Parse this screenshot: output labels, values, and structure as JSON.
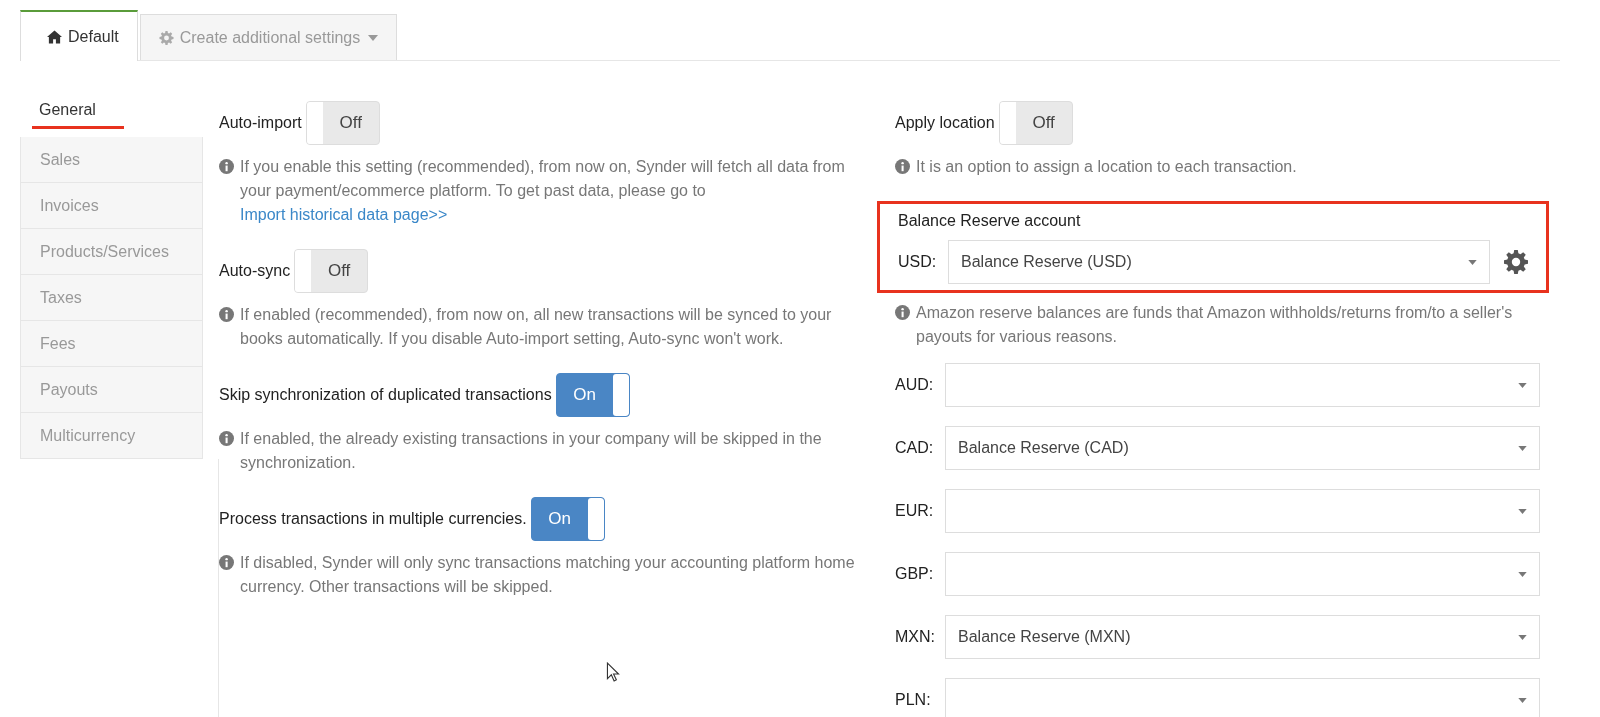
{
  "tabs": [
    {
      "label": "Default",
      "selected": true
    },
    {
      "label": "Create additional settings",
      "selected": false
    }
  ],
  "sidebar": {
    "items": [
      {
        "label": "General",
        "selected": true
      },
      {
        "label": "Sales",
        "selected": false
      },
      {
        "label": "Invoices",
        "selected": false
      },
      {
        "label": "Products/Services",
        "selected": false
      },
      {
        "label": "Taxes",
        "selected": false
      },
      {
        "label": "Fees",
        "selected": false
      },
      {
        "label": "Payouts",
        "selected": false
      },
      {
        "label": "Multicurrency",
        "selected": false
      }
    ]
  },
  "settings": [
    {
      "label": "Auto-import",
      "toggle": {
        "on": false,
        "label": "Off"
      },
      "help": "If you enable this setting (recommended), from now on, Synder will fetch all data from your payment/ecommerce platform. To get past data, please go to ",
      "link": "Import historical data page>>"
    },
    {
      "label": "Auto-sync",
      "toggle": {
        "on": false,
        "label": "Off"
      },
      "help": "If enabled (recommended), from now on, all new transactions will be synced to your books automatically. If you disable Auto-import setting, Auto-sync won't work."
    },
    {
      "label": "Skip synchronization of duplicated transactions",
      "toggle": {
        "on": true,
        "label": "On"
      },
      "help": "If enabled, the already existing transactions in your company will be skipped in the synchronization."
    },
    {
      "label": "Process transactions in multiple currencies.",
      "toggle": {
        "on": true,
        "label": "On"
      },
      "help": "If disabled, Synder will only sync transactions matching your accounting platform home currency. Other transactions will be skipped."
    }
  ],
  "location": {
    "label": "Apply location",
    "toggle": {
      "on": false,
      "label": "Off"
    },
    "help": "It is an option to assign a location to each transaction."
  },
  "balance_reserve": {
    "title": "Balance Reserve account",
    "highlighted": true,
    "primary": {
      "currency": "USD:",
      "value": "Balance Reserve (USD)"
    },
    "help": "Amazon reserve balances are funds that Amazon withholds/returns from/to a seller's payouts for various reasons.",
    "rows": [
      {
        "currency": "AUD:"
      },
      {
        "currency": "CAD:",
        "value": "Balance Reserve (CAD)"
      },
      {
        "currency": "EUR:"
      },
      {
        "currency": "GBP:"
      },
      {
        "currency": "MXN:",
        "value": "Balance Reserve (MXN)"
      },
      {
        "currency": "PLN:"
      }
    ]
  }
}
